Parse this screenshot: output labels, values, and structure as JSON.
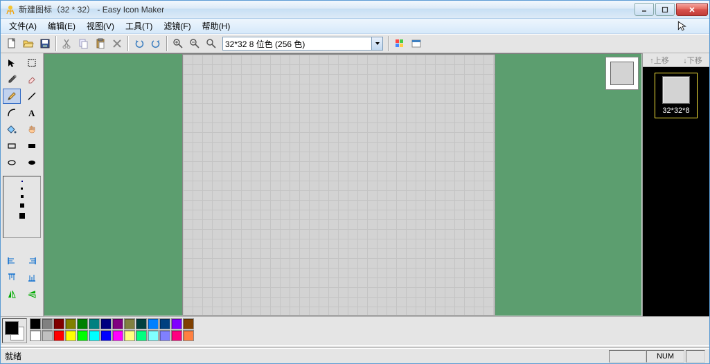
{
  "title": "新建图标（32 * 32） - Easy Icon Maker",
  "menus": [
    "文件(A)",
    "编辑(E)",
    "视图(V)",
    "工具(T)",
    "滤镜(F)",
    "帮助(H)"
  ],
  "size_format_label": "32*32  8 位色 (256 色)",
  "right_panel": {
    "move_up": "↑上移",
    "move_down": "↓下移",
    "thumb_label": "32*32*8"
  },
  "palette_row1": [
    "#000000",
    "#808080",
    "#800000",
    "#808000",
    "#008000",
    "#008080",
    "#000080",
    "#800080",
    "#808040",
    "#004040",
    "#0080ff",
    "#004080",
    "#8000ff",
    "#804000"
  ],
  "palette_row2": [
    "#ffffff",
    "#c0c0c0",
    "#ff0000",
    "#ffff00",
    "#00ff00",
    "#00ffff",
    "#0000ff",
    "#ff00ff",
    "#ffff80",
    "#00ff80",
    "#80ffff",
    "#8080ff",
    "#ff0080",
    "#ff8040"
  ],
  "status": {
    "ready": "就绪",
    "num": "NUM"
  }
}
